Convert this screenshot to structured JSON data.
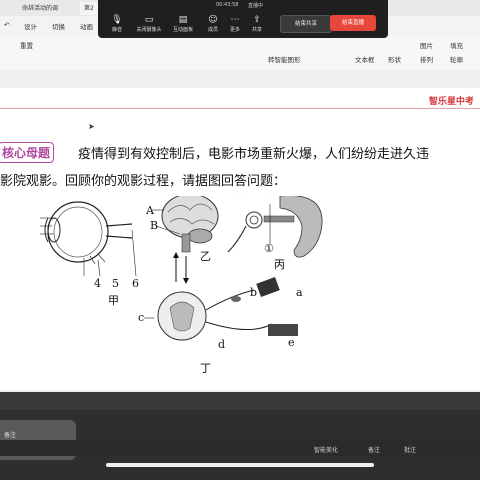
{
  "app": {
    "tabs": [
      "命辞活动的调",
      "第2"
    ],
    "menu": [
      "设计",
      "切换",
      "动画"
    ],
    "ribbon": {
      "items": [
        "重置",
        "文本框",
        "形状",
        "排列",
        "图片",
        "填充",
        "轮廓",
        "转智能图形"
      ]
    }
  },
  "meeting": {
    "timer": "00:43:58",
    "speaker": "直播中",
    "buttons": [
      {
        "label": "静音",
        "icon": "microphone-icon"
      },
      {
        "label": "关闭摄像头",
        "icon": "camera-icon"
      },
      {
        "label": "互动面板",
        "icon": "interaction-icon"
      },
      {
        "label": "成员",
        "icon": "members-icon"
      },
      {
        "label": "更多",
        "icon": "more-icon"
      },
      {
        "label": "共享",
        "icon": "share-icon"
      }
    ],
    "stop_share": "结束共享",
    "end_live": "结束直播"
  },
  "slide": {
    "brand": "智乐星中考",
    "question_label": "核心母题",
    "line1": "疫情得到有效控制后，电影市场重新火爆，人们纷纷走进久违",
    "line2": "影院观影。回顾你的观影过程，请据图回答问题：",
    "diagram": {
      "labels": [
        "1",
        "2",
        "3",
        "4",
        "5",
        "6",
        "甲",
        "A",
        "B",
        "乙",
        "④",
        "③",
        "②",
        "①",
        "丙",
        "a",
        "b",
        "c",
        "d",
        "e",
        "丁"
      ]
    }
  },
  "statusbar": {
    "notes": "备注",
    "smart": "智能美化",
    "comment": "批注",
    "annot": "备注"
  }
}
